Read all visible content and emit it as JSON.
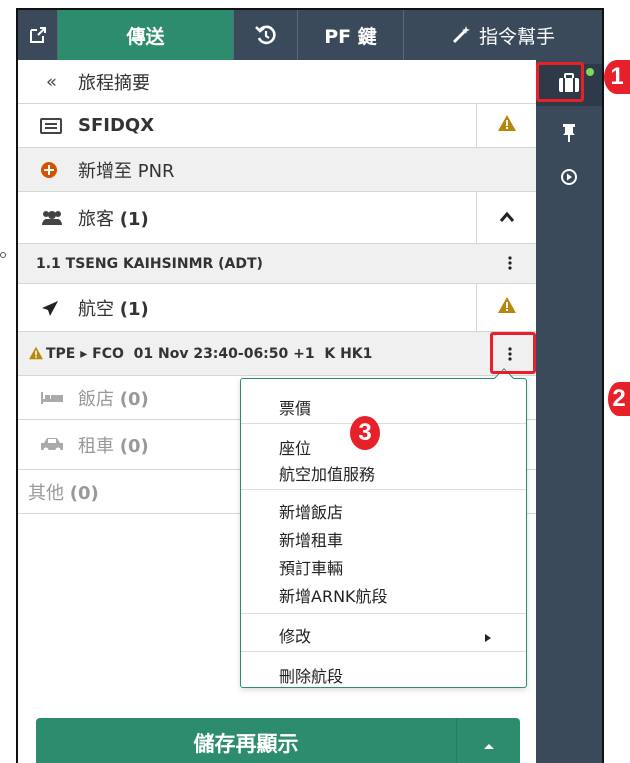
{
  "tabs": {
    "popout": "",
    "send": "傳送",
    "history": "",
    "pf_keys": "PF 鍵",
    "assistant": "指令幫手"
  },
  "trip": {
    "summary_label": "旅程摘要",
    "record_locator": "SFIDQX",
    "add_to_pnr": "新增至 PNR",
    "travelers": {
      "label": "旅客",
      "count": "(1)"
    },
    "traveler_row": "1.1 TSENG KAIHSINMR (ADT)",
    "air": {
      "label": "航空",
      "count": "(1)"
    },
    "segment": "TPE ▸ FCO  01 Nov 23:40-06:50 +1  K HK1",
    "hotel": {
      "label": "飯店",
      "count": "(0)"
    },
    "car": {
      "label": "租車",
      "count": "(0)"
    },
    "other": {
      "label": "其他",
      "count": "(0)"
    }
  },
  "context_menu": {
    "items": [
      "票價",
      "座位",
      "航空加值服務",
      "新增飯店",
      "新增租車",
      "預訂車輛",
      "新增ARNK航段",
      "修改",
      "刪除航段"
    ]
  },
  "save_button": {
    "label": "儲存再顯示"
  },
  "annotations": {
    "badge1": "1",
    "badge2": "2",
    "badge3": "3"
  },
  "colors": {
    "green": "#2e8c6e",
    "dark": "#3a4a5b",
    "warning": "#b8860b",
    "red": "#e8202a"
  },
  "icons": [
    "popout-icon",
    "history-icon",
    "magic-wand-icon",
    "suitcase-icon",
    "pin-icon",
    "eye-icon",
    "double-chevron-left-icon",
    "ticket-icon",
    "plus-circle-icon",
    "users-icon",
    "plane-icon",
    "bed-icon",
    "car-icon",
    "warning-icon",
    "chevron-up-icon",
    "kebab-icon",
    "chevron-right-icon",
    "caret-up-icon"
  ]
}
